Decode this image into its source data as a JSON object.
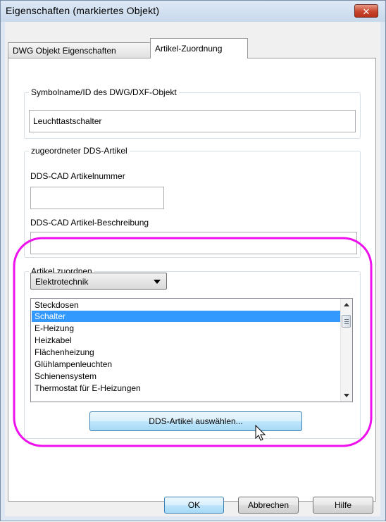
{
  "window": {
    "title": "Eigenschaften (markiertes Objekt)",
    "close_label": "✕"
  },
  "tabs": [
    {
      "label": "DWG Objekt Eigenschaften",
      "active": false
    },
    {
      "label": "Artikel-Zuordnung",
      "active": true
    }
  ],
  "symbol_group": {
    "legend": "Symbolname/ID des DWG/DXF-Objekt",
    "value": "Leuchttastschalter"
  },
  "dds_group": {
    "legend": "zugeordneter DDS-Artikel",
    "number_label": "DDS-CAD Artikelnummer",
    "number_value": "",
    "description_label": "DDS-CAD Artikel-Beschreibung",
    "description_value": ""
  },
  "assign_group": {
    "legend": "Artikel zuordnen",
    "category_selected": "Elektrotechnik",
    "items": [
      "Steckdosen",
      "Schalter",
      "E-Heizung",
      "Heizkabel",
      "Flächenheizung",
      "Glühlampenleuchten",
      "Schienensystem",
      "Thermostat für E-Heizungen"
    ],
    "selected_index": 1,
    "select_button": "DDS-Artikel auswählen..."
  },
  "footer": {
    "ok": "OK",
    "cancel": "Abbrechen",
    "help": "Hilfe"
  },
  "colors": {
    "annotation_ring": "#ee11ee",
    "selection": "#3399ff",
    "close_button": "#c8442c"
  }
}
